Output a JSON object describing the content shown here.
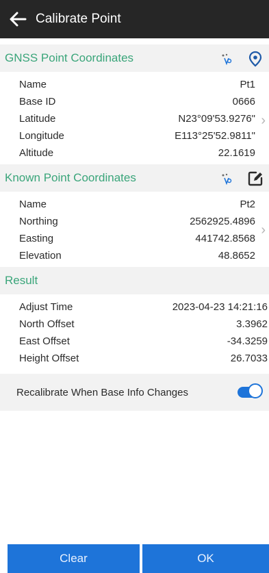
{
  "header": {
    "title": "Calibrate Point",
    "back_icon": "arrow-left-icon"
  },
  "gnss": {
    "title": "GNSS Point Coordinates",
    "icons": [
      "stakeout-icon",
      "location-pin-icon"
    ],
    "rows": [
      {
        "label": "Name",
        "value": "Pt1"
      },
      {
        "label": "Base ID",
        "value": "0666"
      },
      {
        "label": "Latitude",
        "value": "N23°09'53.9276\""
      },
      {
        "label": "Longitude",
        "value": "E113°25'52.9811\""
      },
      {
        "label": "Altitude",
        "value": "22.1619"
      }
    ]
  },
  "known": {
    "title": "Known Point Coordinates",
    "icons": [
      "stakeout-icon",
      "edit-icon"
    ],
    "rows": [
      {
        "label": "Name",
        "value": "Pt2"
      },
      {
        "label": "Northing",
        "value": "2562925.4896"
      },
      {
        "label": "Easting",
        "value": "441742.8568"
      },
      {
        "label": "Elevation",
        "value": "48.8652"
      }
    ]
  },
  "result": {
    "title": "Result",
    "rows": [
      {
        "label": "Adjust Time",
        "value": "2023-04-23 14:21:16"
      },
      {
        "label": "North Offset",
        "value": "3.3962"
      },
      {
        "label": "East Offset",
        "value": "-34.3259"
      },
      {
        "label": "Height Offset",
        "value": "26.7033"
      }
    ]
  },
  "recalibrate": {
    "label": "Recalibrate When Base Info Changes",
    "enabled": true
  },
  "buttons": {
    "clear": "Clear",
    "ok": "OK"
  },
  "colors": {
    "accent": "#3aa57a",
    "primary": "#1e74d9",
    "header_bg": "#262626",
    "section_bg": "#f2f2f2"
  }
}
